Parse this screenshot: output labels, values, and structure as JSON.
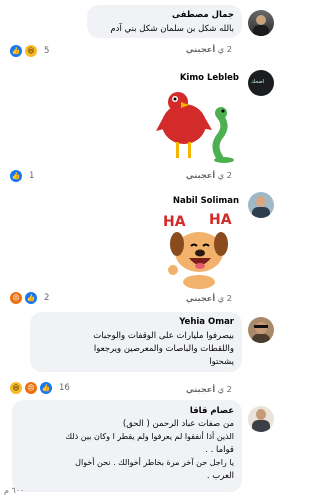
{
  "comments": [
    {
      "author": "جمال مصطفى",
      "text": "بالله شكل بن سلمان شكل بني آدم",
      "time": "2 ي",
      "like": "أعجبني",
      "reactions_count": "5"
    },
    {
      "author": "Kimo Lebleb",
      "time": "2 ي",
      "like": "أعجبني",
      "reactions_count": "1",
      "avatar_text": "اضحك"
    },
    {
      "author": "Nabil Soliman",
      "time": "2 ي",
      "like": "أعجبني",
      "reactions_count": "2",
      "sticker_text_1": "HA",
      "sticker_text_2": "HA"
    },
    {
      "author": "Yehia Omar",
      "text_lines": [
        "بيصرفوا مليارات على الوقفات والوجبات",
        "واللقطات والباصات والمعرصين ويرجعوا",
        "يشحتوا"
      ],
      "time": "2 ي",
      "like": "أعجبني",
      "reactions_count": "16"
    },
    {
      "author": "عصام قاقا",
      "text_lines": [
        "من صفات عباد الرحمن  ( الحق)",
        "الذين أذا أنفقوا لم يعرفوا ولم يقطر ا وكان بين ذلك",
        "قواما . .",
        "يا راجل حن آخر مرة بخاطر أخوالك . نحن أخوال",
        "العرب ."
      ]
    }
  ],
  "footer_partial": "٦٠٠ م"
}
